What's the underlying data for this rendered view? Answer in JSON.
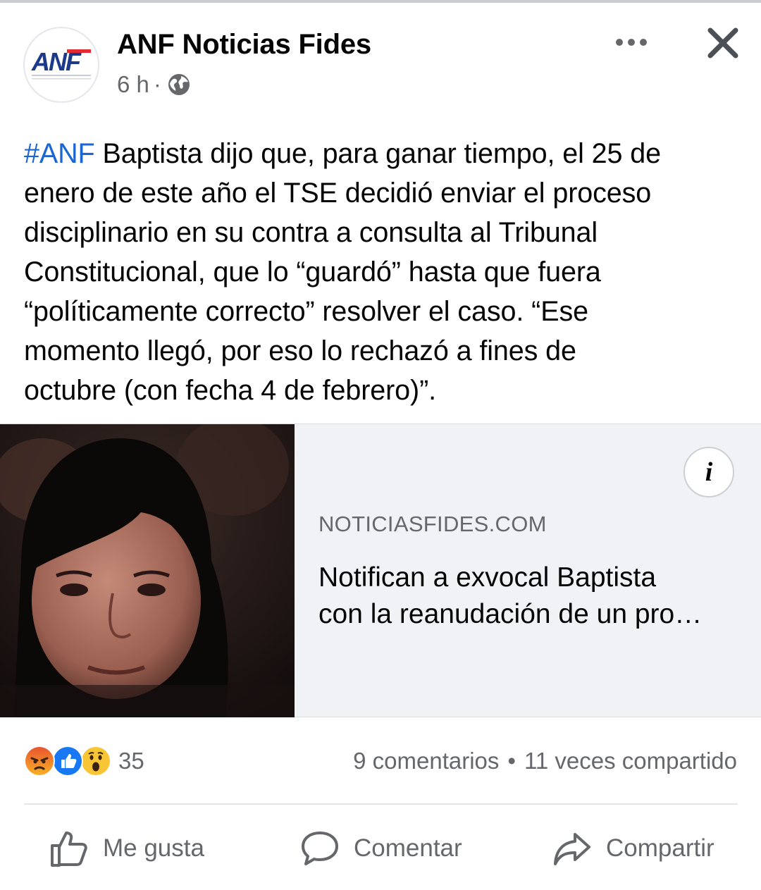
{
  "post": {
    "page_name": "ANF Noticias Fides",
    "time": "6 h",
    "separator": "·",
    "visibility_icon": "globe-icon",
    "avatar_logo": "ANF",
    "hashtag": "#ANF",
    "body_lines": [
      " Baptista dijo que, para ganar tiempo, el 25 de",
      "enero de este año el TSE decidió enviar el proceso",
      "disciplinario en su contra a consulta al Tribunal",
      "Constitucional, que lo “guardó” hasta que fuera",
      "“políticamente correcto” resolver el caso. “Ese",
      "momento llegó, por eso lo rechazó a fines de",
      "octubre (con fecha 4 de febrero)”."
    ]
  },
  "link_preview": {
    "domain": "NOTICIASFIDES.COM",
    "title_lines": [
      "Notifican a exvocal Baptista",
      "con la reanudación de un pro…"
    ],
    "info_label": "i"
  },
  "stats": {
    "reactions": [
      "angry-reaction-icon",
      "like-reaction-icon",
      "wow-reaction-icon"
    ],
    "reaction_count": "35",
    "comments": "9 comentarios",
    "bullet": "•",
    "shares": "11 veces compartido"
  },
  "actions": {
    "like": "Me gusta",
    "comment": "Comentar",
    "share": "Compartir"
  },
  "colors": {
    "hashtag": "#1b66d2",
    "secondary_text": "#65676b",
    "card_background": "#f0f2f5",
    "brand_red": "#e42a32",
    "brand_blue": "#1d3a8a"
  }
}
